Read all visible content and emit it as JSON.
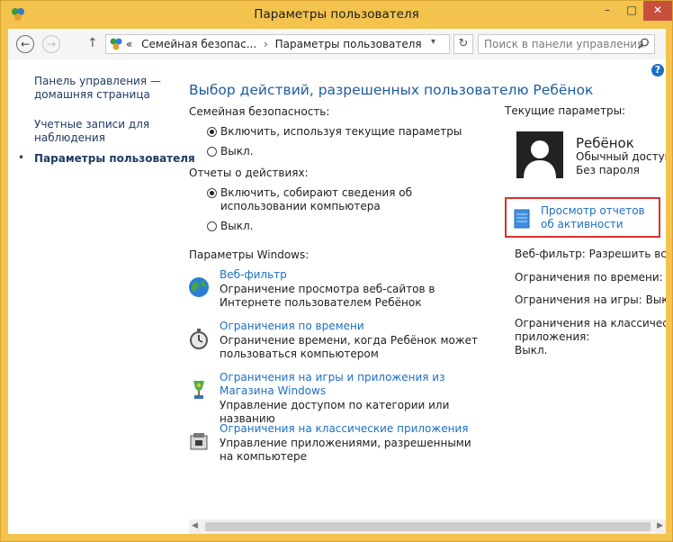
{
  "window": {
    "title": "Параметры пользователя",
    "min": "–",
    "max": "□",
    "close": "✕"
  },
  "toolbar": {
    "back": "←",
    "forward": "→",
    "up": "↑",
    "breadcrumb_more": "«",
    "crumb1": "Семейная безопас...",
    "crumb_sep": "›",
    "crumb2": "Параметры пользователя",
    "dropdown": "▾",
    "refresh": "↻",
    "search_placeholder": "Поиск в панели управления"
  },
  "help": "?",
  "sidebar": {
    "home_line1": "Панель управления —",
    "home_line2": "домашняя страница",
    "accounts_line1": "Учетные записи для",
    "accounts_line2": "наблюдения",
    "bullet": "•",
    "current": "Параметры пользователя"
  },
  "main": {
    "heading": "Выбор действий, разрешенных пользователю Ребёнок",
    "family_label": "Семейная безопасность:",
    "family_on": "Включить, используя текущие параметры",
    "family_off": "Выкл.",
    "reports_label": "Отчеты о действиях:",
    "reports_on": "Включить, собирают сведения об использовании компьютера",
    "reports_off": "Выкл.",
    "windows_label": "Параметры Windows:",
    "features": [
      {
        "icon": "globe-icon",
        "title": "Веб-фильтр",
        "desc": "Ограничение просмотра веб-сайтов в Интернете пользователем Ребёнок"
      },
      {
        "icon": "stopwatch-icon",
        "title": "Ограничения по времени",
        "desc": "Ограничение времени, когда Ребёнок может пользоваться компьютером"
      },
      {
        "icon": "trophy-icon",
        "title": "Ограничения на игры и приложения из Магазина Windows",
        "desc": "Управление доступом по категории или названию"
      },
      {
        "icon": "apps-icon",
        "title": "Ограничения на классические приложения",
        "desc": "Управление приложениями, разрешенными на компьютере"
      }
    ]
  },
  "current": {
    "label": "Текущие параметры:",
    "user_name": "Ребёнок",
    "user_type": "Обычный доступ",
    "user_pwd": "Без пароля",
    "report_link": "Просмотр отчетов об активности",
    "web_filter": "Веб-фильтр: Разрешить все",
    "time_limits": "Ограничения по времени: Выкл.",
    "games": "Ограничения на игры: Выкл.",
    "classic_line1": "Ограничения на классические",
    "classic_line2": "приложения:",
    "classic_line3": "Выкл."
  },
  "colors": {
    "frame": "#f3c34e",
    "link": "#1d6fc4",
    "heading": "#1e5a9e",
    "highlight": "#d8322b"
  }
}
